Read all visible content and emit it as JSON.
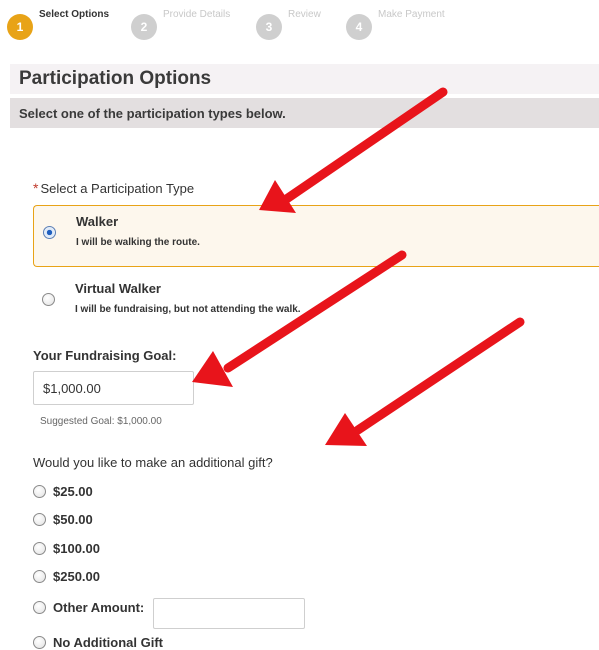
{
  "steps": [
    {
      "number": "1",
      "label": "Select Options",
      "active": true
    },
    {
      "number": "2",
      "label": "Provide Details",
      "active": false
    },
    {
      "number": "3",
      "label": "Review",
      "active": false
    },
    {
      "number": "4",
      "label": "Make Payment",
      "active": false
    }
  ],
  "header": {
    "title": "Participation Options",
    "subtitle": "Select one of the participation types below."
  },
  "participation": {
    "required_mark": "*",
    "label": "Select a Participation Type",
    "options": [
      {
        "title": "Walker",
        "description": "I will be walking the route.",
        "selected": true
      },
      {
        "title": "Virtual Walker",
        "description": "I will be fundraising, but not attending the walk.",
        "selected": false
      }
    ]
  },
  "goal": {
    "label": "Your Fundraising Goal:",
    "value": "$1,000.00",
    "suggested": "Suggested Goal: $1,000.00"
  },
  "gift": {
    "question": "Would you like to make an additional gift?",
    "options": [
      "$25.00",
      "$50.00",
      "$100.00",
      "$250.00",
      "Other Amount:",
      "No Additional Gift"
    ],
    "other_value": ""
  },
  "colors": {
    "accent": "#e8a317",
    "selected_bg": "#fdf7ed",
    "annotation_arrow": "#e8141b"
  }
}
